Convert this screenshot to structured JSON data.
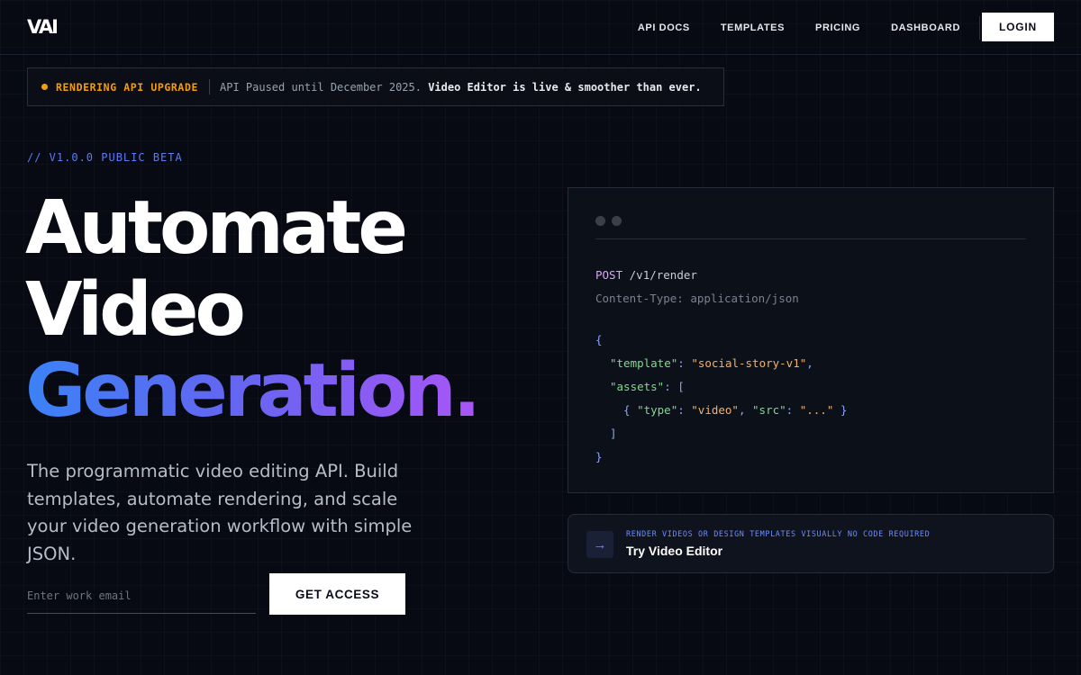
{
  "nav": {
    "logo": "VAI",
    "links": [
      "API DOCS",
      "TEMPLATES",
      "PRICING",
      "DASHBOARD"
    ],
    "login": "LOGIN"
  },
  "banner": {
    "tag": "RENDERING API UPGRADE",
    "text_plain": "API Paused until December 2025.",
    "text_bold": "Video Editor is live & smoother than ever."
  },
  "hero": {
    "version": "// V1.0.0 PUBLIC BETA",
    "line1": "Automate",
    "line2": "Video",
    "line3": "Generation.",
    "description": "The programmatic video editing API. Build templates, automate rendering, and scale your video generation workflow with simple JSON."
  },
  "signup": {
    "placeholder": "Enter work email",
    "button": "GET ACCESS"
  },
  "code": {
    "method": "POST",
    "path": "/v1/render",
    "header": "Content-Type: application/json",
    "open_brace": "{",
    "template_key": "\"template\"",
    "template_value": "\"social-story-v1\"",
    "assets_key": "\"assets\"",
    "open_bracket": "[",
    "item_open": "{",
    "type_key": "\"type\"",
    "type_value": "\"video\"",
    "src_key": "\"src\"",
    "src_value": "\"...\"",
    "item_close": "}",
    "close_bracket": "]",
    "close_brace": "}"
  },
  "editor_card": {
    "caption": "RENDER VIDEOS OR DESIGN TEMPLATES VISUALLY NO CODE REQUIRED",
    "title": "Try Video Editor",
    "icon": "arrow-right-icon"
  },
  "colors": {
    "background": "#070a13",
    "accent_orange": "#f59e0b",
    "accent_blue": "#5b7cf5",
    "gradient_start": "#3b82f6",
    "gradient_end": "#a855f7"
  }
}
